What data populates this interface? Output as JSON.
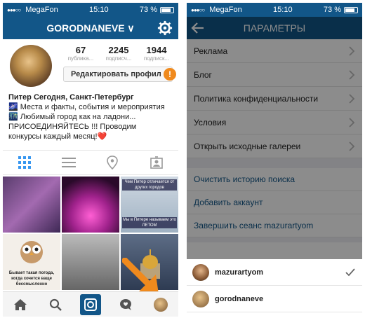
{
  "left_screen": {
    "status": {
      "signal": "●●●○○",
      "carrier": "MegaFon",
      "time": "15:10",
      "battery": "73 %"
    },
    "header": {
      "username": "GORODNANEVE ∨"
    },
    "stats": [
      {
        "value": "67",
        "label": "публика..."
      },
      {
        "value": "2245",
        "label": "подписч..."
      },
      {
        "value": "1944",
        "label": "подписк..."
      }
    ],
    "edit_profile_label": "Редактировать профил",
    "alert_mark": "!",
    "bio": {
      "name": "Питер Сегодня, Санкт-Петербург",
      "line1": "🌌 Места и факты, события и мероприятия",
      "line2": "🌃 Любимый город как на ладони...",
      "line3": "ПРИСОЕДИНЯЙТЕСЬ !!! Проводим",
      "line4": "конкурсы каждый месяц!❤️"
    },
    "tiles": {
      "t3_caption_top": "Чем Питер отличается от других городов",
      "t3_caption_bottom": "Мы в Питере называем это ЛЕТОМ",
      "t4_caption": "Бывает такая погода, когда хочется ваще бессмысленно"
    },
    "colors": {
      "brand": "#125688",
      "accent": "#f08a1d"
    }
  },
  "right_screen": {
    "status": {
      "signal": "●●●○○",
      "carrier": "MegaFon",
      "time": "15:10",
      "battery": "73 %"
    },
    "header": {
      "title": "ПАРАМЕТРЫ"
    },
    "items": [
      "Реклама",
      "Блог",
      "Политика конфиденциальности",
      "Условия",
      "Открыть исходные галереи"
    ],
    "links": [
      "Очистить историю поиска",
      "Добавить аккаунт",
      "Завершить сеанс mazurartyom"
    ],
    "accounts": [
      {
        "name": "mazurartyom",
        "active": true
      },
      {
        "name": "gorodnaneve",
        "active": false
      }
    ]
  }
}
